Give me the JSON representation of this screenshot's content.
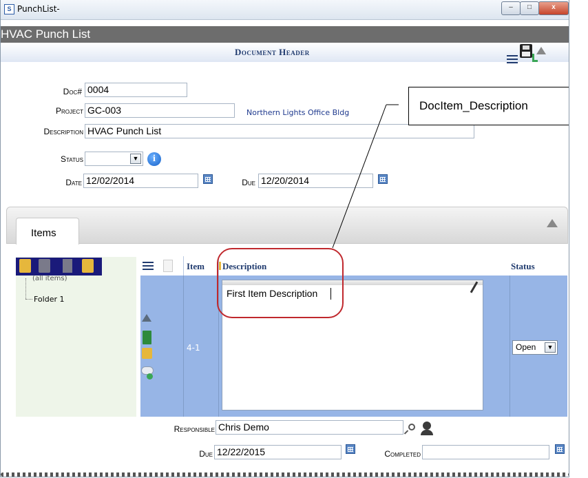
{
  "window": {
    "title": "PunchList-",
    "minimize": "–",
    "maximize": "□",
    "close": "x"
  },
  "app": {
    "title": "HVAC Punch List"
  },
  "header": {
    "title": "Document Header"
  },
  "form": {
    "doc_label": "Doc#",
    "doc_value": "0004",
    "project_label": "Project",
    "project_value": "GC-003",
    "project_name": "Northern Lights Office Bldg",
    "description_label": "Description",
    "description_value": "HVAC Punch List",
    "status_label": "Status",
    "status_value": "",
    "date_label": "Date",
    "date_value": "12/02/2014",
    "due_label": "Due",
    "due_value": "12/20/2014"
  },
  "callout": {
    "text": "DocItem_Description"
  },
  "tabs": {
    "items": "Items"
  },
  "tree": {
    "all_items": "(all items)",
    "folder": "Folder 1"
  },
  "grid": {
    "col_item": "Item",
    "col_description": "Description",
    "col_status": "Status",
    "row": {
      "item": "4-1",
      "description": "First Item Description",
      "status": "Open"
    }
  },
  "detail": {
    "responsible_label": "Responsible",
    "responsible_value": "Chris Demo",
    "due_label": "Due",
    "due_value": "12/22/2015",
    "completed_label": "Completed",
    "completed_value": ""
  },
  "colors": {
    "accent": "#1f3a6e",
    "row_highlight": "#97b5e6",
    "tree_bg": "#eef5e9",
    "callout_oval": "#c0282d"
  }
}
